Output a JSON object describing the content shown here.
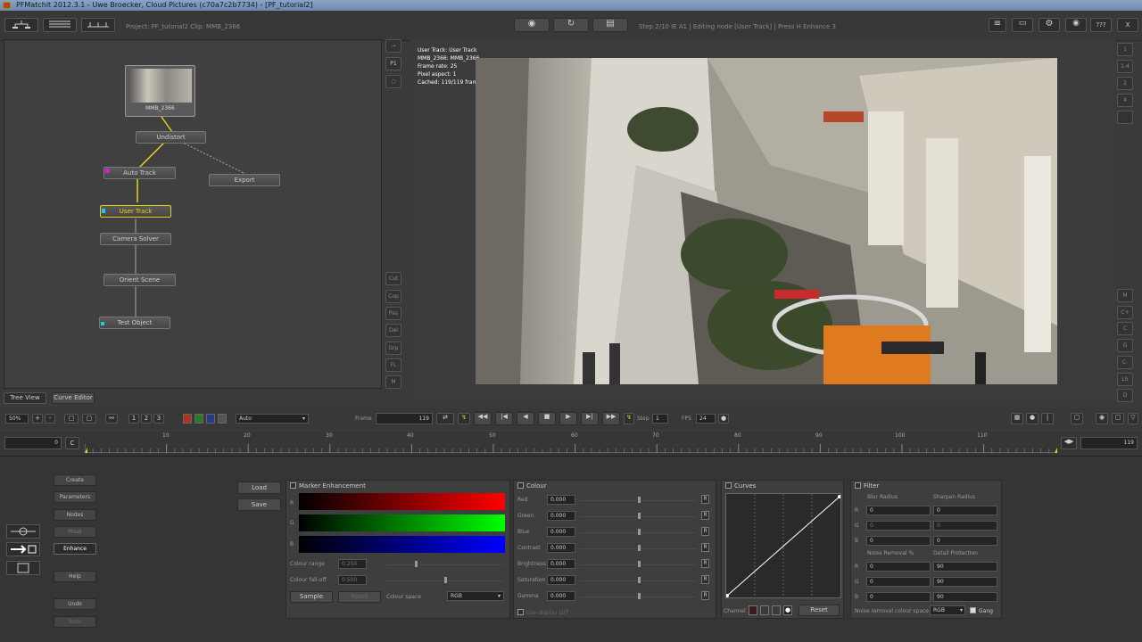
{
  "window": {
    "title": "PFMatchit 2012.3.1 - Uwe Broecker, Cloud Pictures (c70a7c2b7734) - [PF_tutorial2]"
  },
  "toolbar": {
    "project": "Project: PF_tutorial2  Clip: MMB_2366",
    "status": "Step 2/10 IE A1 | Editing node [User Track] | Press H Enhance 3",
    "help": "???",
    "close": "X"
  },
  "tree_tabs": [
    "Tree View",
    "Curve Editor"
  ],
  "nodes": [
    {
      "label": "MMB_2366"
    },
    {
      "label": "Undistort"
    },
    {
      "label": "Auto Track"
    },
    {
      "label": "Export"
    },
    {
      "label": "User Track"
    },
    {
      "label": "Camera Solver"
    },
    {
      "label": "Orient Scene"
    },
    {
      "label": "Test Object"
    }
  ],
  "side_buttons_left": [
    "P1",
    "Cut",
    "Cop",
    "Pas",
    "Del",
    "Grp",
    "FL",
    "M"
  ],
  "side_buttons_right": [
    "1",
    "1-4",
    "2",
    "4",
    "M",
    "C+",
    "C",
    "G",
    "C-",
    "LS",
    "D"
  ],
  "overlay": [
    "User Track: User Track",
    "MMB_2366: MMB_2366",
    "Frame rate: 25",
    "Pixel aspect: 1",
    "Cached: 119/119 frames"
  ],
  "transport": {
    "zoom": "50%",
    "display": "Auto",
    "frame_label": "Frame",
    "frame": "119",
    "step_label": "Step",
    "step": "1",
    "fps_label": "FPS",
    "fps": "24"
  },
  "timeline": {
    "start": "0",
    "end": "119",
    "ticks": [
      "10",
      "20",
      "30",
      "40",
      "50",
      "60",
      "70",
      "80",
      "90",
      "100",
      "110"
    ]
  },
  "left_menu": [
    "Create",
    "Parameters",
    "Nodes",
    "Mask",
    "Enhance",
    "Help",
    "Undo",
    "Redo"
  ],
  "load_save": [
    "Load",
    "Save"
  ],
  "marker": {
    "title": "Marker Enhancement",
    "channels": [
      "R",
      "G",
      "B"
    ],
    "colour_range_label": "Colour range",
    "colour_range": "0.250",
    "colour_falloff_label": "Colour fall-off",
    "colour_falloff": "0.500",
    "sample": "Sample",
    "reset": "Reset",
    "colour_space_label": "Colour space",
    "colour_space": "RGB"
  },
  "colour": {
    "title": "Colour",
    "rows": [
      {
        "label": "Red",
        "value": "0.000"
      },
      {
        "label": "Green",
        "value": "0.000"
      },
      {
        "label": "Blue",
        "value": "0.000"
      },
      {
        "label": "Contrast",
        "value": "0.000"
      },
      {
        "label": "Brightness",
        "value": "0.000"
      },
      {
        "label": "Saturation",
        "value": "0.000"
      },
      {
        "label": "Gamma",
        "value": "0.000"
      }
    ],
    "reset_glyph": "R",
    "lut_label": "Use display LUT"
  },
  "curves": {
    "title": "Curves",
    "channel_label": "Channel",
    "reset": "Reset"
  },
  "filter": {
    "title": "Filter",
    "blur_label": "Blur Radius",
    "sharpen_label": "Sharpen Radius",
    "rgb": [
      "R",
      "G",
      "B"
    ],
    "blur": [
      "0",
      "0",
      "0"
    ],
    "sharpen": [
      "0",
      "0",
      "0"
    ],
    "noise_label": "Noise Removal %",
    "detail_label": "Detail Protection",
    "noise": [
      "0",
      "0",
      "0"
    ],
    "detail": [
      "90",
      "90",
      "90"
    ],
    "space_label": "Noise removal colour space",
    "space": "RGB",
    "gang": "Gang"
  },
  "colors": {
    "selected_node": "#e6d21a",
    "marker_red": "#ff0000",
    "marker_green": "#00ff00",
    "marker_blue": "#0000ff"
  }
}
